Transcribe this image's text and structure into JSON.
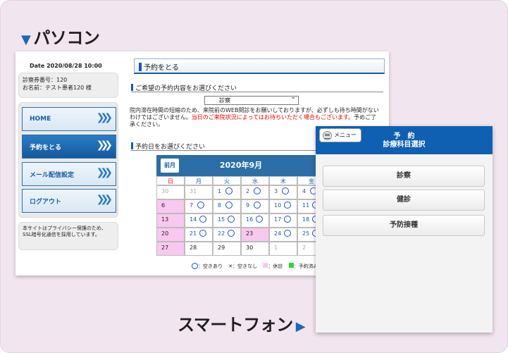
{
  "headings": {
    "pc": "パソコン",
    "smartphone": "スマートフォン"
  },
  "pc": {
    "date_text": "Date 2020/08/28 10:00",
    "patient_id": "診察券番号：120",
    "patient_name": "お名前：テスト患者120 様",
    "menu": [
      {
        "label": "HOME"
      },
      {
        "label": "予約をとる"
      },
      {
        "label": "メール配信設定"
      },
      {
        "label": "ログアウト"
      }
    ],
    "notice": "本サイトはプライバシー保護のため、SSL暗号化通信を採用しています。",
    "page_title": "予約をとる",
    "section1": "ご希望の予約内容をお選びください",
    "select_value": "診察",
    "desc_normal": "院内滞在時間の短縮のため、来院前のWEB問診をお願いしておりますが、必ずしも待ち時間がないわけではございません。",
    "desc_red": "当日のご来院状況によってはお待ちいただく場合もございます。",
    "desc_tail": "予めご了承ください。",
    "section2": "予約日をお選びください",
    "calendar": {
      "prev_label": "前月",
      "month_label": "2020年9月",
      "weekdays": [
        "日",
        "月",
        "火",
        "水",
        "木",
        "金"
      ],
      "rows": [
        [
          "30",
          "31",
          "1",
          "2",
          "3",
          "4"
        ],
        [
          "6",
          "7",
          "8",
          "9",
          "10",
          "11"
        ],
        [
          "13",
          "14",
          "15",
          "16",
          "17",
          "18"
        ],
        [
          "20",
          "21",
          "22",
          "23",
          "24",
          "25"
        ],
        [
          "27",
          "28",
          "29",
          "30",
          "1",
          "2"
        ]
      ]
    },
    "legend": {
      "available": "：空きあり",
      "full": "：空きなし",
      "closed": "：休診",
      "reserved": "：予約済み"
    },
    "legend_x": "✕"
  },
  "sp": {
    "menu_label": "メニュー",
    "title_line1": "予　約",
    "title_line2": "診療科目選択",
    "options": [
      {
        "label": "診察"
      },
      {
        "label": "健診"
      },
      {
        "label": "予防接種"
      }
    ]
  }
}
